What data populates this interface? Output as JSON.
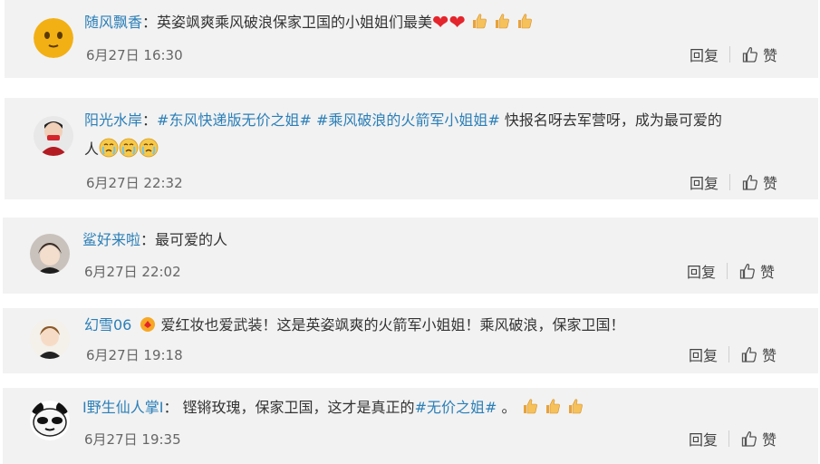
{
  "comments": [
    {
      "user": "随风飘香",
      "sep": "：",
      "text": "英姿飒爽乘风破浪保家卫国的小姐姐们最美",
      "date": "6月27日 16:30",
      "reply": "回复",
      "like": "赞"
    },
    {
      "user": "阳光水岸",
      "sep": "：",
      "tag1": "#东风快递版无价之姐#",
      "tag2": "#乘风破浪的火箭军小姐姐#",
      "text": " 快报名呀去军营呀，成为最可爱的",
      "text2": "人",
      "date": "6月27日 22:32",
      "reply": "回复",
      "like": "赞"
    },
    {
      "user": "鲨好来啦",
      "sep": "：",
      "text": "最可爱的人",
      "date": "6月27日 22:02",
      "reply": "回复",
      "like": "赞"
    },
    {
      "user": "幻雪06",
      "text": " 爱红妆也爱武装！这是英姿飒爽的火箭军小姐姐！乘风破浪，保家卫国！",
      "date": "6月27日 19:18",
      "reply": "回复",
      "like": "赞"
    },
    {
      "user": "I野生仙人掌I",
      "sep": "：",
      "text": " 铿锵玫瑰，保家卫国，这才是真正的",
      "tag": "#无价之姐#",
      "text2": " 。",
      "date": "6月27日 19:35",
      "reply": "回复",
      "like": "赞"
    }
  ],
  "colors": {
    "user": "#2b7fb8",
    "card": "#f2f2f2",
    "heart": "#e4252c"
  }
}
